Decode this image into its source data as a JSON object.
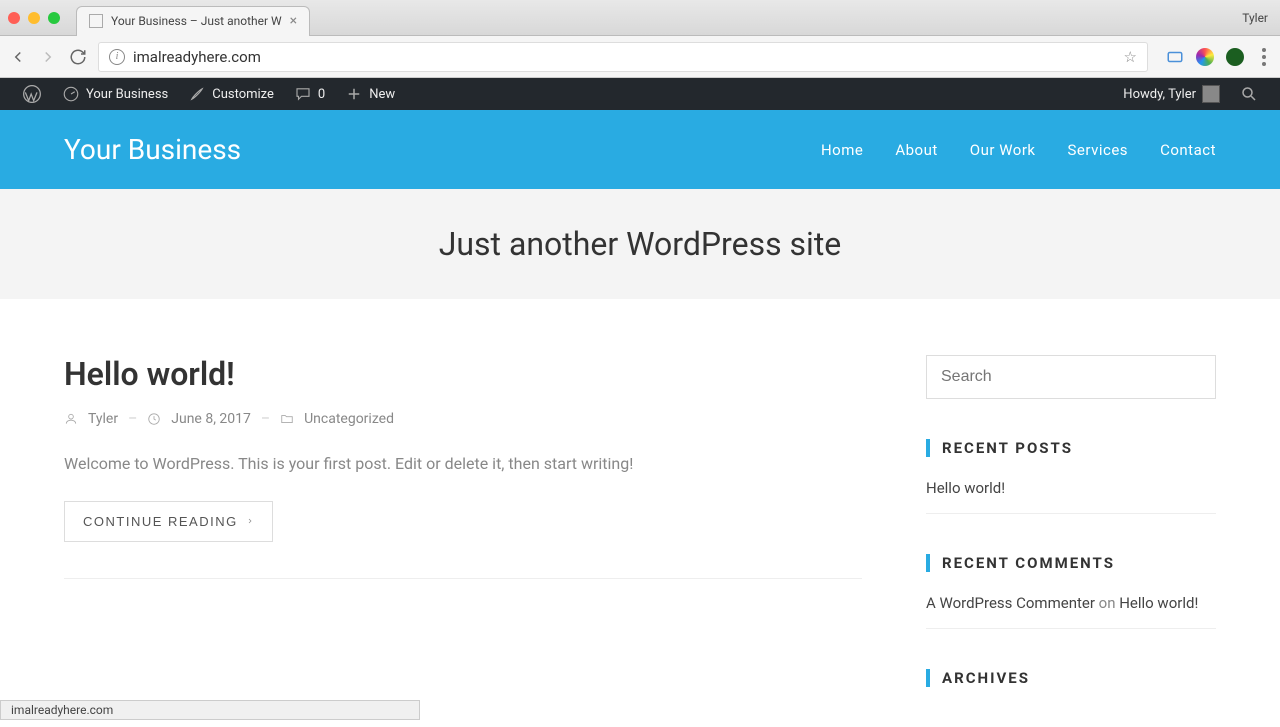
{
  "browser": {
    "profile": "Tyler",
    "tab_title": "Your Business – Just another W",
    "url": "imalreadyhere.com",
    "status_url": "imalreadyhere.com"
  },
  "wp_admin": {
    "site_name": "Your Business",
    "customize": "Customize",
    "comments_count": "0",
    "new_label": "New",
    "howdy": "Howdy, Tyler"
  },
  "header": {
    "site_title": "Your Business",
    "nav": [
      "Home",
      "About",
      "Our Work",
      "Services",
      "Contact"
    ]
  },
  "tagline": "Just another WordPress site",
  "post": {
    "title": "Hello world!",
    "author": "Tyler",
    "date": "June 8, 2017",
    "category": "Uncategorized",
    "excerpt": "Welcome to WordPress. This is your first post. Edit or delete it, then start writing!",
    "continue": "CONTINUE READING"
  },
  "sidebar": {
    "search_placeholder": "Search",
    "recent_posts_title": "RECENT POSTS",
    "recent_posts": [
      "Hello world!"
    ],
    "recent_comments_title": "RECENT COMMENTS",
    "recent_comment_author": "A WordPress Commenter",
    "recent_comment_on": " on ",
    "recent_comment_post": "Hello world!",
    "archives_title": "ARCHIVES"
  }
}
